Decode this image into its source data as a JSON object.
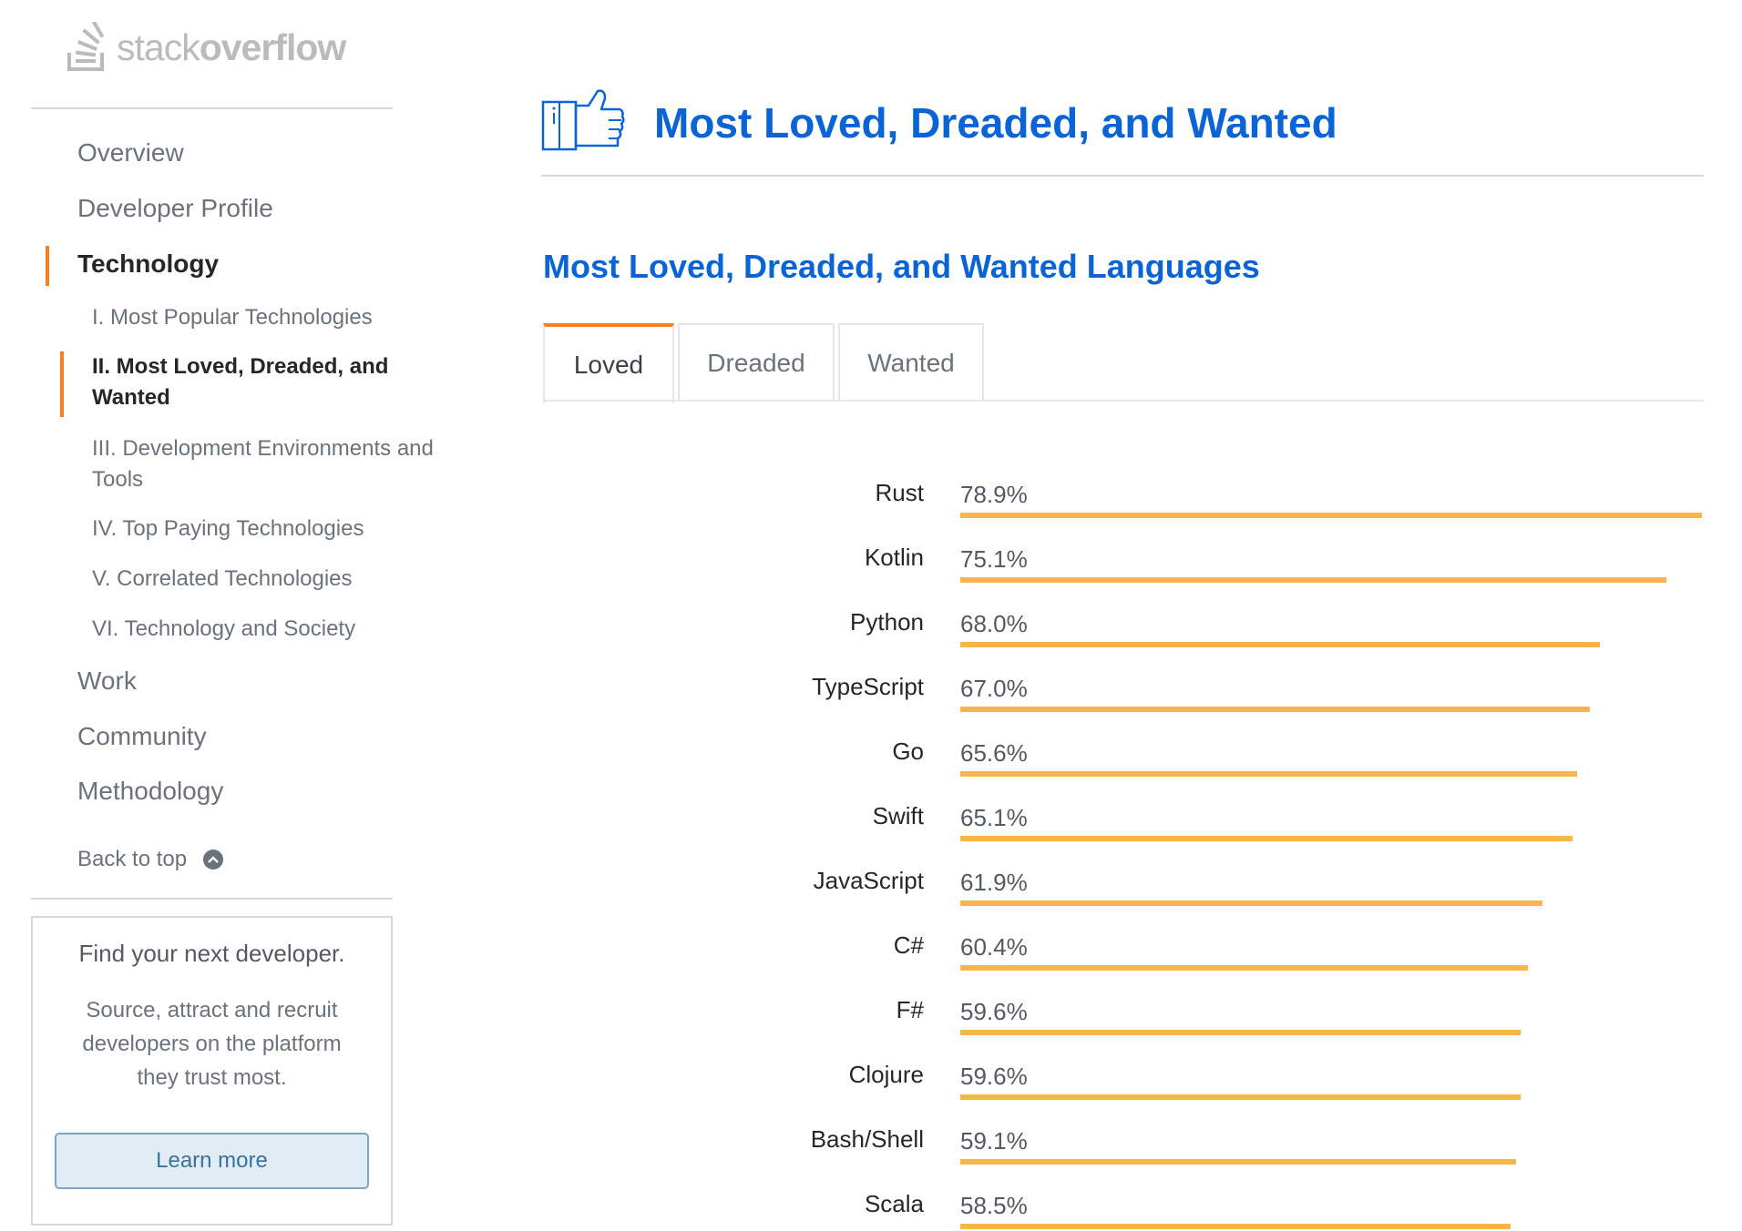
{
  "logo": {
    "text_light": "stack",
    "text_bold": "overflow"
  },
  "sidebar": {
    "main_items": [
      {
        "label": "Overview",
        "active": false
      },
      {
        "label": "Developer Profile",
        "active": false
      },
      {
        "label": "Technology",
        "active": true
      },
      {
        "label": "Work",
        "active": false
      },
      {
        "label": "Community",
        "active": false
      },
      {
        "label": "Methodology",
        "active": false
      }
    ],
    "sub_items": [
      {
        "label": "I. Most Popular Technologies",
        "active": false
      },
      {
        "label": "II. Most Loved, Dreaded, and Wanted",
        "active": true
      },
      {
        "label": "III. Development Environments and Tools",
        "active": false
      },
      {
        "label": "IV. Top Paying Technologies",
        "active": false
      },
      {
        "label": "V. Correlated Technologies",
        "active": false
      },
      {
        "label": "VI. Technology and Society",
        "active": false
      }
    ],
    "back_to_top": "Back to top"
  },
  "promo": {
    "title": "Find your next developer.",
    "text": "Source, attract and recruit developers on the platform they trust most.",
    "button": "Learn more"
  },
  "main": {
    "page_title": "Most Loved, Dreaded, and Wanted",
    "section_title": "Most Loved, Dreaded, and Wanted Languages",
    "tabs": [
      {
        "label": "Loved",
        "active": true
      },
      {
        "label": "Dreaded",
        "active": false
      },
      {
        "label": "Wanted",
        "active": false
      }
    ]
  },
  "colors": {
    "accent_orange": "#f48024",
    "title_blue": "#0a64d6",
    "bar_color": "#f7b54a"
  },
  "chart_data": {
    "type": "bar",
    "orientation": "horizontal",
    "categories": [
      "Rust",
      "Kotlin",
      "Python",
      "TypeScript",
      "Go",
      "Swift",
      "JavaScript",
      "C#",
      "F#",
      "Clojure",
      "Bash/Shell",
      "Scala"
    ],
    "values": [
      78.9,
      75.1,
      68.0,
      67.0,
      65.6,
      65.1,
      61.9,
      60.4,
      59.6,
      59.6,
      59.1,
      58.5
    ],
    "value_labels": [
      "78.9%",
      "75.1%",
      "68.0%",
      "67.0%",
      "65.6%",
      "65.1%",
      "61.9%",
      "60.4%",
      "59.6%",
      "59.6%",
      "59.1%",
      "58.5%"
    ],
    "title": "",
    "xlabel": "",
    "ylabel": "",
    "grid": false
  }
}
